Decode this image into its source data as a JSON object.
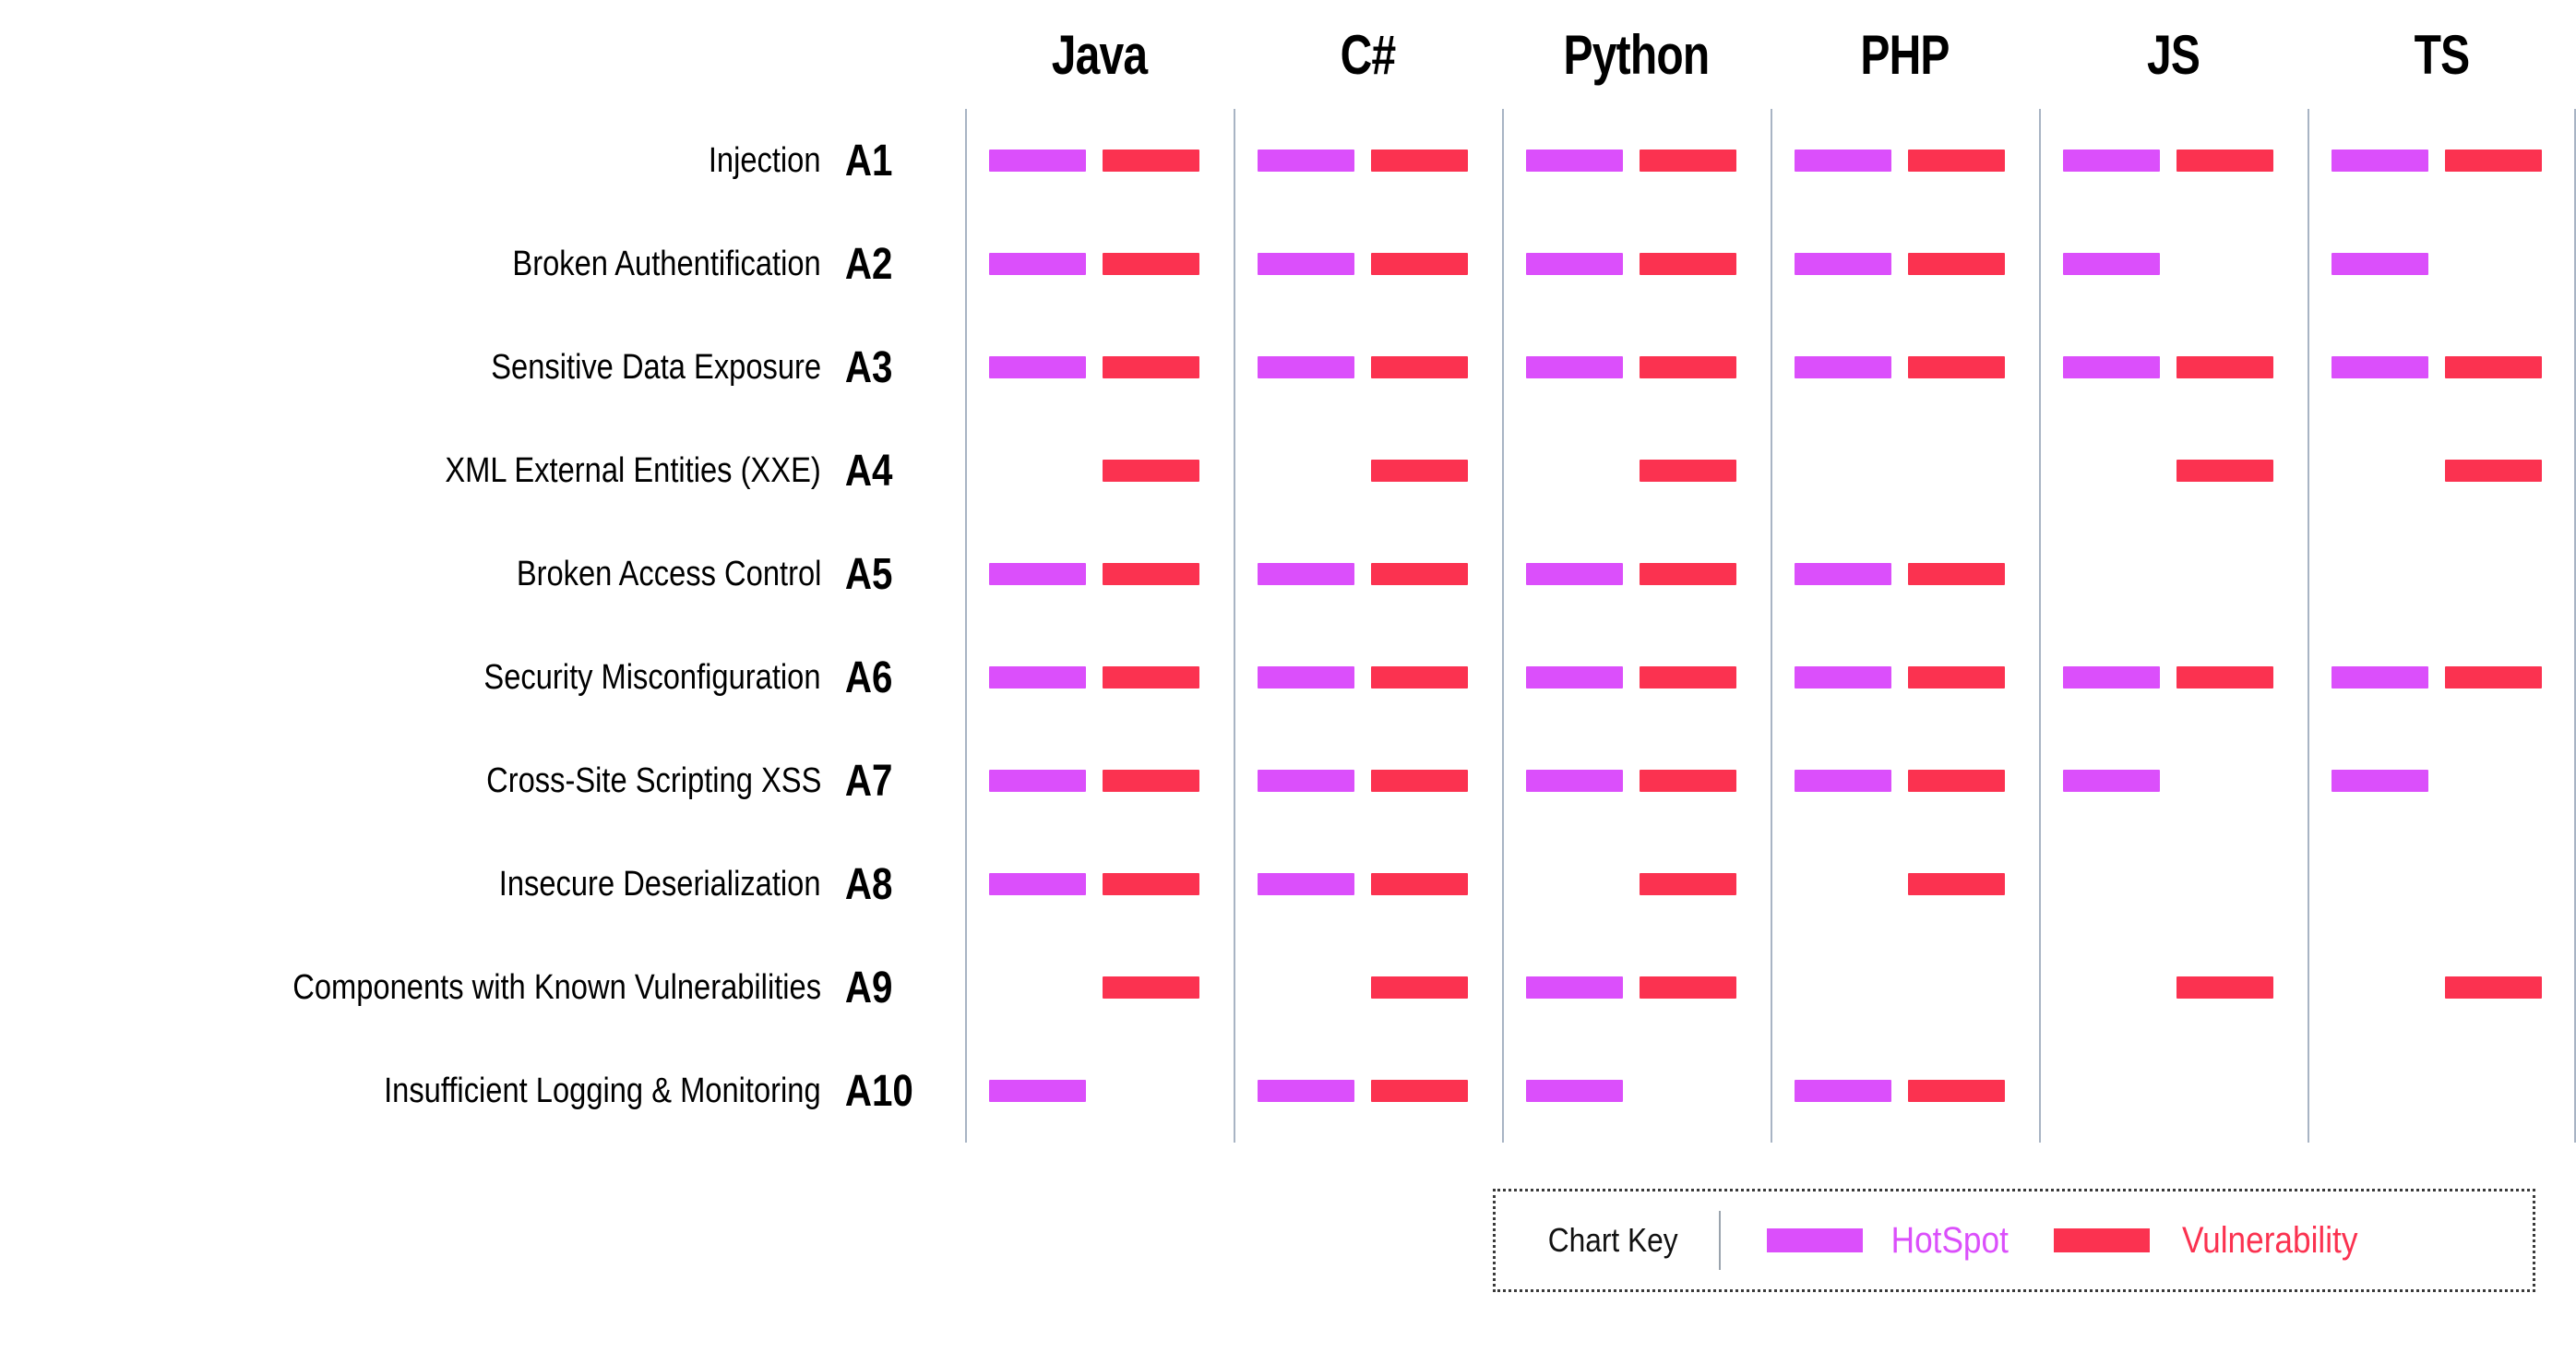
{
  "chart_data": {
    "type": "heatmap",
    "title": "",
    "xlabel": "",
    "ylabel": "",
    "categories": [
      "Java",
      "C#",
      "Python",
      "PHP",
      "JS",
      "TS"
    ],
    "row_codes": [
      "A1",
      "A2",
      "A3",
      "A4",
      "A5",
      "A6",
      "A7",
      "A8",
      "A9",
      "A10"
    ],
    "row_labels": [
      "Injection",
      "Broken Authentification",
      "Sensitive Data Exposure",
      "XML External Entities (XXE)",
      "Broken Access Control",
      "Security Misconfiguration",
      "Cross-Site Scripting XSS",
      "Insecure Deserialization",
      "Components with Known Vulnerabilities",
      "Insufficient Logging & Monitoring"
    ],
    "series": [
      {
        "name": "HotSpot",
        "color": "#DB4FFB"
      },
      {
        "name": "Vulnerability",
        "color": "#FB3250"
      }
    ],
    "legend_position": "bottom-right",
    "grid": true,
    "cells": [
      {
        "code": "A1",
        "values": [
          [
            1,
            1
          ],
          [
            1,
            1
          ],
          [
            1,
            1
          ],
          [
            1,
            1
          ],
          [
            1,
            1
          ],
          [
            1,
            1
          ]
        ]
      },
      {
        "code": "A2",
        "values": [
          [
            1,
            1
          ],
          [
            1,
            1
          ],
          [
            1,
            1
          ],
          [
            1,
            1
          ],
          [
            1,
            0
          ],
          [
            1,
            0
          ]
        ]
      },
      {
        "code": "A3",
        "values": [
          [
            1,
            1
          ],
          [
            1,
            1
          ],
          [
            1,
            1
          ],
          [
            1,
            1
          ],
          [
            1,
            1
          ],
          [
            1,
            1
          ]
        ]
      },
      {
        "code": "A4",
        "values": [
          [
            0,
            1
          ],
          [
            0,
            1
          ],
          [
            0,
            1
          ],
          [
            0,
            0
          ],
          [
            0,
            1
          ],
          [
            0,
            1
          ]
        ]
      },
      {
        "code": "A5",
        "values": [
          [
            1,
            1
          ],
          [
            1,
            1
          ],
          [
            1,
            1
          ],
          [
            1,
            1
          ],
          [
            0,
            0
          ],
          [
            0,
            0
          ]
        ]
      },
      {
        "code": "A6",
        "values": [
          [
            1,
            1
          ],
          [
            1,
            1
          ],
          [
            1,
            1
          ],
          [
            1,
            1
          ],
          [
            1,
            1
          ],
          [
            1,
            1
          ]
        ]
      },
      {
        "code": "A7",
        "values": [
          [
            1,
            1
          ],
          [
            1,
            1
          ],
          [
            1,
            1
          ],
          [
            1,
            1
          ],
          [
            1,
            0
          ],
          [
            1,
            0
          ]
        ]
      },
      {
        "code": "A8",
        "values": [
          [
            1,
            1
          ],
          [
            1,
            1
          ],
          [
            0,
            1
          ],
          [
            0,
            1
          ],
          [
            0,
            0
          ],
          [
            0,
            0
          ]
        ]
      },
      {
        "code": "A9",
        "values": [
          [
            0,
            1
          ],
          [
            0,
            1
          ],
          [
            1,
            1
          ],
          [
            0,
            0
          ],
          [
            0,
            1
          ],
          [
            0,
            1
          ]
        ]
      },
      {
        "code": "A10",
        "values": [
          [
            1,
            0
          ],
          [
            1,
            1
          ],
          [
            1,
            0
          ],
          [
            1,
            1
          ],
          [
            0,
            0
          ],
          [
            0,
            0
          ]
        ]
      }
    ]
  },
  "header": {
    "languages": [
      "Java",
      "C#",
      "Python",
      "PHP",
      "JS",
      "TS"
    ]
  },
  "rows": [
    {
      "label": "Injection",
      "code": "A1"
    },
    {
      "label": "Broken Authentification",
      "code": "A2"
    },
    {
      "label": "Sensitive Data Exposure",
      "code": "A3"
    },
    {
      "label": "XML External Entities (XXE)",
      "code": "A4"
    },
    {
      "label": "Broken Access Control",
      "code": "A5"
    },
    {
      "label": "Security Misconfiguration",
      "code": "A6"
    },
    {
      "label": "Cross-Site Scripting XSS",
      "code": "A7"
    },
    {
      "label": "Insecure Deserialization",
      "code": "A8"
    },
    {
      "label": "Components with Known Vulnerabilities",
      "code": "A9"
    },
    {
      "label": "Insufficient Logging & Monitoring",
      "code": "A10"
    }
  ],
  "legend": {
    "title": "Chart Key",
    "items": [
      {
        "label": "HotSpot",
        "color": "#DB4FFB"
      },
      {
        "label": "Vulnerability",
        "color": "#FB3250"
      }
    ]
  }
}
